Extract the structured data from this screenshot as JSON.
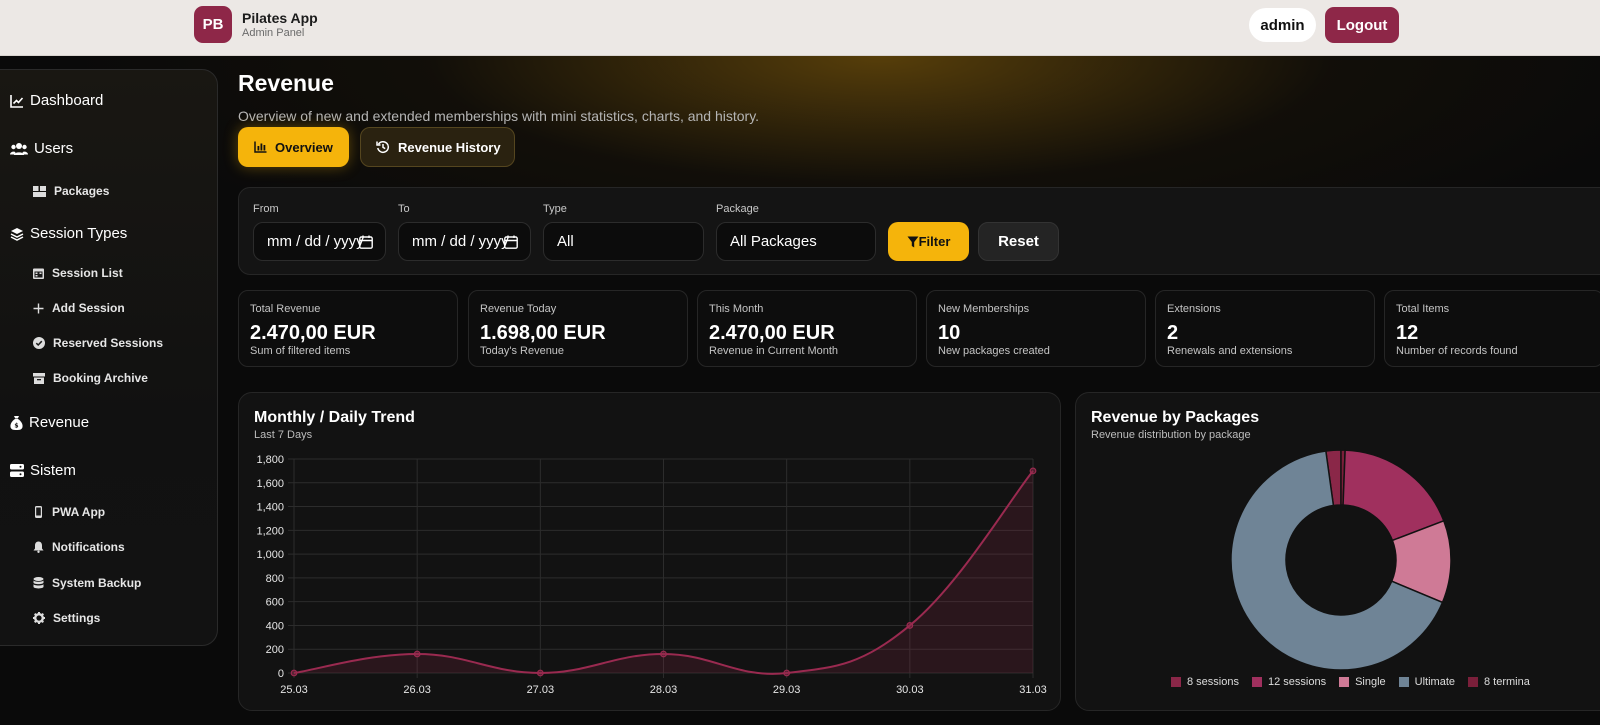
{
  "header": {
    "logo_text": "PB",
    "app_title": "Pilates App",
    "app_subtitle": "Admin Panel",
    "user_label": "admin",
    "logout_label": "Logout"
  },
  "sidebar": {
    "dashboard": "Dashboard",
    "users": "Users",
    "packages": "Packages",
    "session_types": "Session Types",
    "session_list": "Session List",
    "add_session": "Add Session",
    "reserved_sessions": "Reserved Sessions",
    "booking_archive": "Booking Archive",
    "revenue": "Revenue",
    "sistem": "Sistem",
    "pwa_app": "PWA App",
    "notifications": "Notifications",
    "system_backup": "System Backup",
    "settings": "Settings"
  },
  "page": {
    "title": "Revenue",
    "description": "Overview of new and extended memberships with mini statistics, charts, and history."
  },
  "tabs": {
    "overview": "Overview",
    "history": "Revenue History"
  },
  "filters": {
    "from_label": "From",
    "from_value": "mm / dd / yyyy",
    "to_label": "To",
    "to_value": "mm / dd / yyyy",
    "type_label": "Type",
    "type_value": "All",
    "package_label": "Package",
    "package_value": "All Packages",
    "filter_button": "Filter",
    "reset_button": "Reset"
  },
  "stats": [
    {
      "label": "Total Revenue",
      "value": "2.470,00 EUR",
      "sub": "Sum of filtered items"
    },
    {
      "label": "Revenue Today",
      "value": "1.698,00 EUR",
      "sub": "Today's Revenue"
    },
    {
      "label": "This Month",
      "value": "2.470,00 EUR",
      "sub": "Revenue in Current Month"
    },
    {
      "label": "New Memberships",
      "value": "10",
      "sub": "New packages created"
    },
    {
      "label": "Extensions",
      "value": "2",
      "sub": "Renewals and extensions"
    },
    {
      "label": "Total Items",
      "value": "12",
      "sub": "Number of records found"
    }
  ],
  "colors": {
    "accent": "#f5b40b",
    "brand": "#8e2748",
    "line": "#9a2a50"
  },
  "chart_data": [
    {
      "type": "line",
      "title": "Monthly / Daily Trend",
      "subtitle": "Last 7 Days",
      "x": [
        "25.03",
        "26.03",
        "27.03",
        "28.03",
        "29.03",
        "30.03",
        "31.03"
      ],
      "series": [
        {
          "values": [
            0,
            160,
            0,
            160,
            0,
            400,
            1700
          ]
        }
      ],
      "ylim": [
        0,
        1800
      ],
      "yticks": [
        0,
        200,
        400,
        600,
        800,
        "1,000",
        "1,200",
        "1,400",
        "1,600",
        "1,800"
      ],
      "grid": true,
      "area_fill": true
    },
    {
      "type": "pie",
      "title": "Revenue by Packages",
      "subtitle": "Revenue distribution by package",
      "labels": [
        "8 sessions",
        "12 sessions",
        "Single",
        "Ultimate",
        "8 termina"
      ],
      "values": [
        2.2,
        18.6,
        12.1,
        66.5,
        0.6
      ],
      "colors": [
        "#8a2748",
        "#a0305e",
        "#cf7a96",
        "#6f8496",
        "#7a1f3a"
      ],
      "donut": true,
      "legend": "bottom"
    }
  ]
}
